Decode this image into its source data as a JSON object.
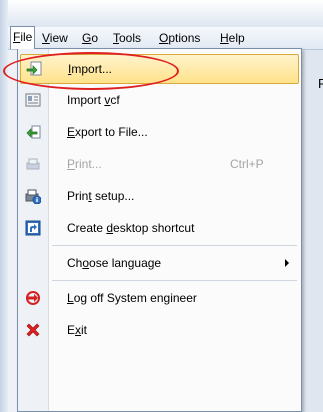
{
  "menubar": {
    "items": [
      {
        "pre": "",
        "u": "F",
        "post": "ile"
      },
      {
        "pre": "",
        "u": "V",
        "post": "iew"
      },
      {
        "pre": "",
        "u": "G",
        "post": "o"
      },
      {
        "pre": "",
        "u": "T",
        "post": "ools"
      },
      {
        "pre": "",
        "u": "O",
        "post": "ptions"
      },
      {
        "pre": "",
        "u": "H",
        "post": "elp"
      }
    ]
  },
  "background_text": "R",
  "file_menu": {
    "items": [
      {
        "pre": "",
        "u": "I",
        "post": "mport...",
        "icon": "import-icon"
      },
      {
        "pre": "Import ",
        "u": "v",
        "post": "cf",
        "icon": "vcard-icon"
      },
      {
        "pre": "",
        "u": "E",
        "post": "xport to File...",
        "icon": "export-icon"
      },
      {
        "pre": "",
        "u": "P",
        "post": "rint...",
        "shortcut": "Ctrl+P",
        "icon": "print-icon",
        "disabled": true
      },
      {
        "pre": "Prin",
        "u": "t",
        "post": " setup...",
        "icon": "print-setup-icon"
      },
      {
        "pre": "Create ",
        "u": "d",
        "post": "esktop shortcut",
        "icon": "shortcut-icon"
      },
      {
        "pre": "Ch",
        "u": "o",
        "post": "ose language",
        "icon": ""
      },
      {
        "pre": "",
        "u": "L",
        "post": "og off System engineer",
        "icon": "logoff-icon"
      },
      {
        "pre": "E",
        "u": "x",
        "post": "it",
        "icon": "exit-icon"
      }
    ]
  },
  "colors": {
    "highlight": "#ffe28a",
    "annotation": "#e02020"
  }
}
